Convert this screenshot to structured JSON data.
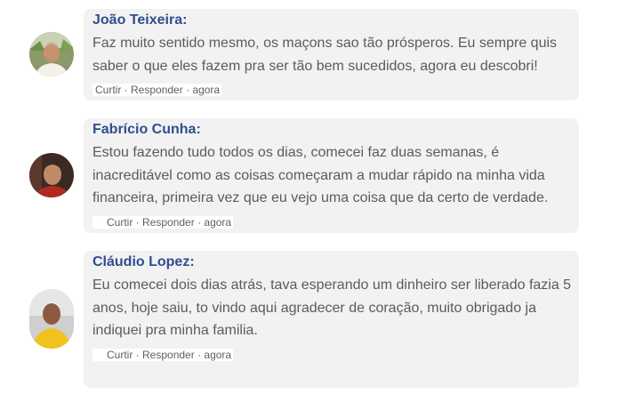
{
  "comments": [
    {
      "author": "João Teixeira:",
      "text": "Faz muito sentido mesmo, os maçons sao tão prósperos. Eu sempre quis saber o que eles fazem pra ser tão bem sucedidos, agora eu descobri!",
      "actions": {
        "like": "Curtir",
        "sep1": " · ",
        "reply": "Responder",
        "sep2": " · ",
        "time": "agora"
      },
      "avatar_icon": "person-photo-icon"
    },
    {
      "author": "Fabrício Cunha:",
      "text": "Estou fazendo tudo todos os dias, comecei faz duas semanas, é inacreditável como as coisas começaram a mudar rápido na minha vida financeira, primeira vez que eu vejo uma coisa que da certo de verdade.",
      "actions": {
        "like": "Curtir",
        "sep1": " · ",
        "reply": "Responder",
        "sep2": " · ",
        "time": "agora"
      },
      "avatar_icon": "person-photo-icon"
    },
    {
      "author": "Cláudio Lopez:",
      "text": "Eu comecei dois dias atrás, tava esperando um dinheiro ser liberado fazia 5 anos, hoje saiu, to vindo aqui agradecer de coração, muito obrigado ja indiquei pra minha familia.",
      "actions": {
        "like": "Curtir",
        "sep1": " · ",
        "reply": "Responder",
        "sep2": " · ",
        "time": "agora"
      },
      "avatar_icon": "person-photo-icon"
    }
  ],
  "colors": {
    "author": "#2f4d8f",
    "text": "#5b5b5b",
    "bubble": "#f2f2f2",
    "page": "#ffffff"
  }
}
